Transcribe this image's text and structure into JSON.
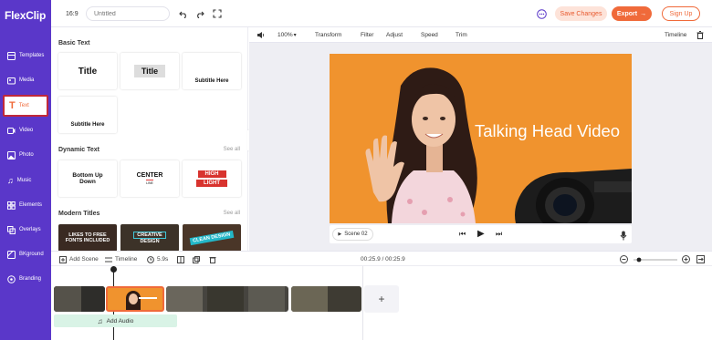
{
  "app": {
    "logo": "FlexClip"
  },
  "sidebar": {
    "items": [
      {
        "label": "Templates",
        "icon": "templates-icon"
      },
      {
        "label": "Media",
        "icon": "media-icon"
      },
      {
        "label": "Text",
        "icon": "text-icon",
        "active": true
      },
      {
        "label": "Video",
        "icon": "video-icon"
      },
      {
        "label": "Photo",
        "icon": "photo-icon"
      },
      {
        "label": "Music",
        "icon": "music-icon"
      },
      {
        "label": "Elements",
        "icon": "elements-icon"
      },
      {
        "label": "Overlays",
        "icon": "overlays-icon"
      },
      {
        "label": "BKground",
        "icon": "background-icon"
      },
      {
        "label": "Branding",
        "icon": "branding-icon"
      }
    ]
  },
  "topbar": {
    "ratio": "16:9",
    "title_placeholder": "Untitled",
    "save_label": "Save Changes",
    "export_label": "Export",
    "signup_label": "Sign Up"
  },
  "panel": {
    "basic_text": {
      "heading": "Basic Text",
      "cards": [
        "Title",
        "Title",
        "Subtitle Here",
        "Subtitle Here"
      ]
    },
    "dynamic_text": {
      "heading": "Dynamic Text",
      "see_all": "See all",
      "cards": [
        {
          "line1": "Bottom Up",
          "line2": "Down"
        },
        {
          "line1": "CENTER",
          "line2": "LINE"
        },
        {
          "line1": "HIGH",
          "line2": "LIGHT"
        }
      ]
    },
    "modern_titles": {
      "heading": "Modern Titles",
      "see_all": "See all",
      "cards": [
        {
          "line1": "LIKES TO FREE",
          "line2": "FONTS INCLUDED"
        },
        {
          "line1": "CREATIVE",
          "line2": "DESIGN"
        },
        {
          "line1": "CLEAN DESIGN",
          "line2": ""
        }
      ]
    }
  },
  "editor_toolbar": {
    "zoom": "100%",
    "items": [
      "Transform",
      "Filter",
      "Adjust",
      "Speed",
      "Trim"
    ],
    "timeline_label": "Timeline"
  },
  "canvas": {
    "overlay_text": "Talking Head Video"
  },
  "playbar": {
    "scene_label": "Scene 02"
  },
  "timeline_bar": {
    "add_scene": "Add Scene",
    "timeline": "Timeline",
    "duration": "5.9s",
    "time_display": "00:25.9 / 00:25.9"
  },
  "track": {
    "add_audio": "Add Audio",
    "add_label": "+"
  },
  "colors": {
    "sidebar": "#5a37c9",
    "accent": "#f06a3a",
    "canvas_bg": "#f0932e",
    "text_card_red": "#d8332e"
  }
}
